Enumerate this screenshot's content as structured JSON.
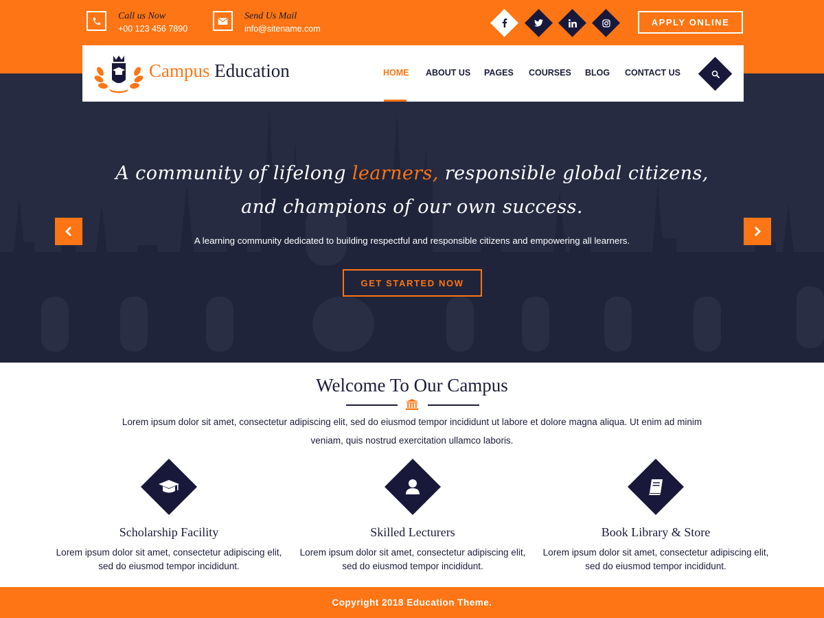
{
  "header": {
    "call": {
      "title": "Call us Now",
      "value": "+00 123 456 7890"
    },
    "mail": {
      "title": "Send Us Mail",
      "value": "info@sitename.com"
    },
    "social": [
      "facebook-icon",
      "twitter-icon",
      "linkedin-icon",
      "instagram-icon"
    ],
    "apply_label": "APPLY ONLINE"
  },
  "nav": {
    "brand_part1": "Campus",
    "brand_part2": "Education",
    "items": [
      "HOME",
      "ABOUT US",
      "PAGES",
      "COURSES",
      "BLOG",
      "CONTACT US"
    ],
    "active": "HOME"
  },
  "hero": {
    "line1_before": "A community of lifelong ",
    "line1_highlight": "learners,",
    "line1_after": " responsible global citizens,",
    "line2": "and champions of our own success.",
    "subtitle": "A learning community dedicated to building respectful and responsible citizens and empowering all learners.",
    "button_label": "GET STARTED NOW"
  },
  "welcome": {
    "title": "Welcome To Our Campus",
    "text": "Lorem ipsum dolor sit amet, consectetur adipiscing elit, sed do eiusmod tempor incididunt ut labore et dolore magna aliqua. Ut enim ad minim veniam, quis nostrud exercitation ullamco laboris."
  },
  "features": [
    {
      "icon": "graduation-cap-icon",
      "title": "Scholarship Facility",
      "text": "Lorem ipsum dolor sit amet, consectetur adipiscing elit, sed do eiusmod tempor incididunt."
    },
    {
      "icon": "user-icon",
      "title": "Skilled Lecturers",
      "text": "Lorem ipsum dolor sit amet, consectetur adipiscing elit, sed do eiusmod tempor incididunt."
    },
    {
      "icon": "book-icon",
      "title": "Book Library & Store",
      "text": "Lorem ipsum dolor sit amet, consectetur adipiscing elit, sed do eiusmod tempor incididunt."
    }
  ],
  "footer": {
    "copyright": "Copyright 2018 Education Theme."
  },
  "colors": {
    "accent": "#fd7514",
    "navy": "#18193a",
    "hero_overlay": "#2d3146"
  }
}
